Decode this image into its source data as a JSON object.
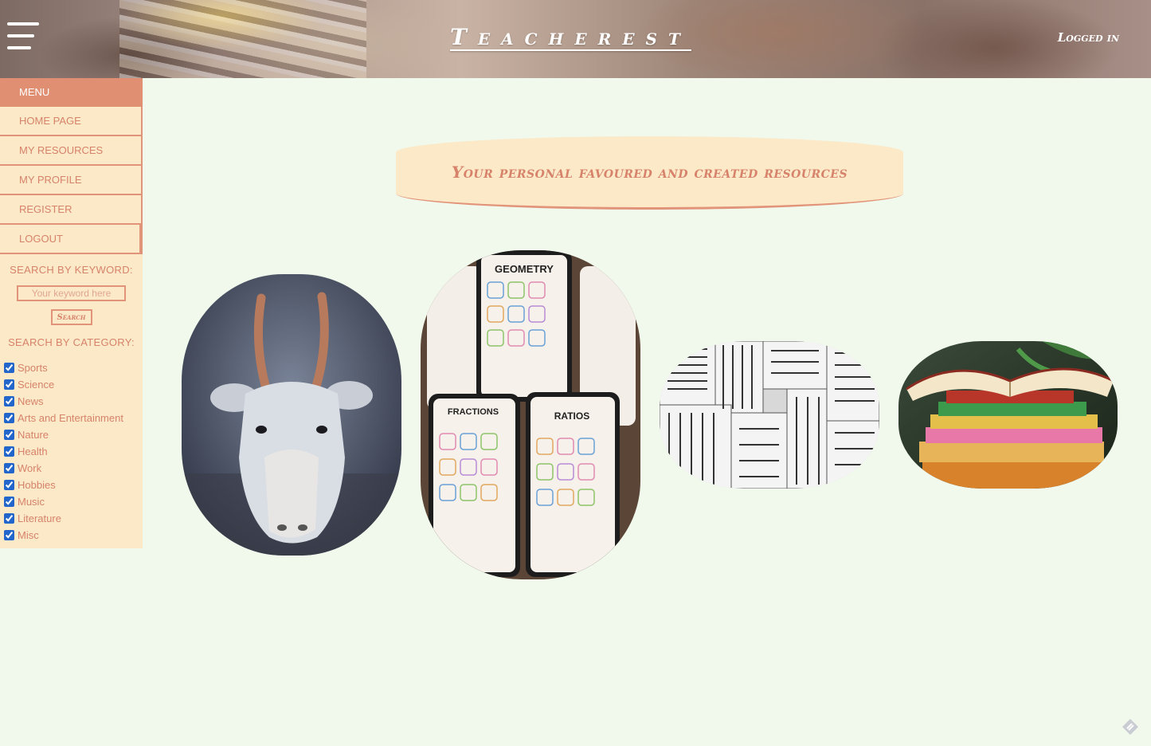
{
  "header": {
    "site_title": "Teacherest",
    "login_status": "Logged in"
  },
  "sidebar": {
    "menu_label": "MENU",
    "nav_items": [
      {
        "label": "HOME PAGE"
      },
      {
        "label": "MY RESOURCES"
      },
      {
        "label": "MY PROFILE"
      },
      {
        "label": "REGISTER"
      },
      {
        "label": "LOGOUT"
      }
    ],
    "keyword_search": {
      "label": "SEARCH BY KEYWORD:",
      "placeholder": "Your keyword here",
      "button_label": "Search"
    },
    "category_search": {
      "label": "SEARCH BY CATEGORY:",
      "categories": [
        {
          "name": "Sports",
          "checked": true
        },
        {
          "name": "Science",
          "checked": true
        },
        {
          "name": "News",
          "checked": true
        },
        {
          "name": "Arts and Entertainment",
          "checked": true
        },
        {
          "name": "Nature",
          "checked": true
        },
        {
          "name": "Health",
          "checked": true
        },
        {
          "name": "Work",
          "checked": true
        },
        {
          "name": "Hobbies",
          "checked": true
        },
        {
          "name": "Music",
          "checked": true
        },
        {
          "name": "Literature",
          "checked": true
        },
        {
          "name": "Misc",
          "checked": true
        }
      ]
    }
  },
  "main": {
    "banner_text": "Your personal favoured and created resources",
    "resource_cards": [
      {
        "image": "saiga-antelope-photo"
      },
      {
        "image": "math-vocabulary-cards-photo",
        "visible_text": [
          "GEOMETRY",
          "FRACTIONS",
          "RATIOS"
        ]
      },
      {
        "image": "black-and-white-bookshelf-photo"
      },
      {
        "image": "open-book-stack-photo"
      }
    ]
  },
  "colors": {
    "background": "#f1f9ec",
    "panel": "#fbe9c8",
    "accent": "#e08f73",
    "text_accent": "#d7826a"
  }
}
